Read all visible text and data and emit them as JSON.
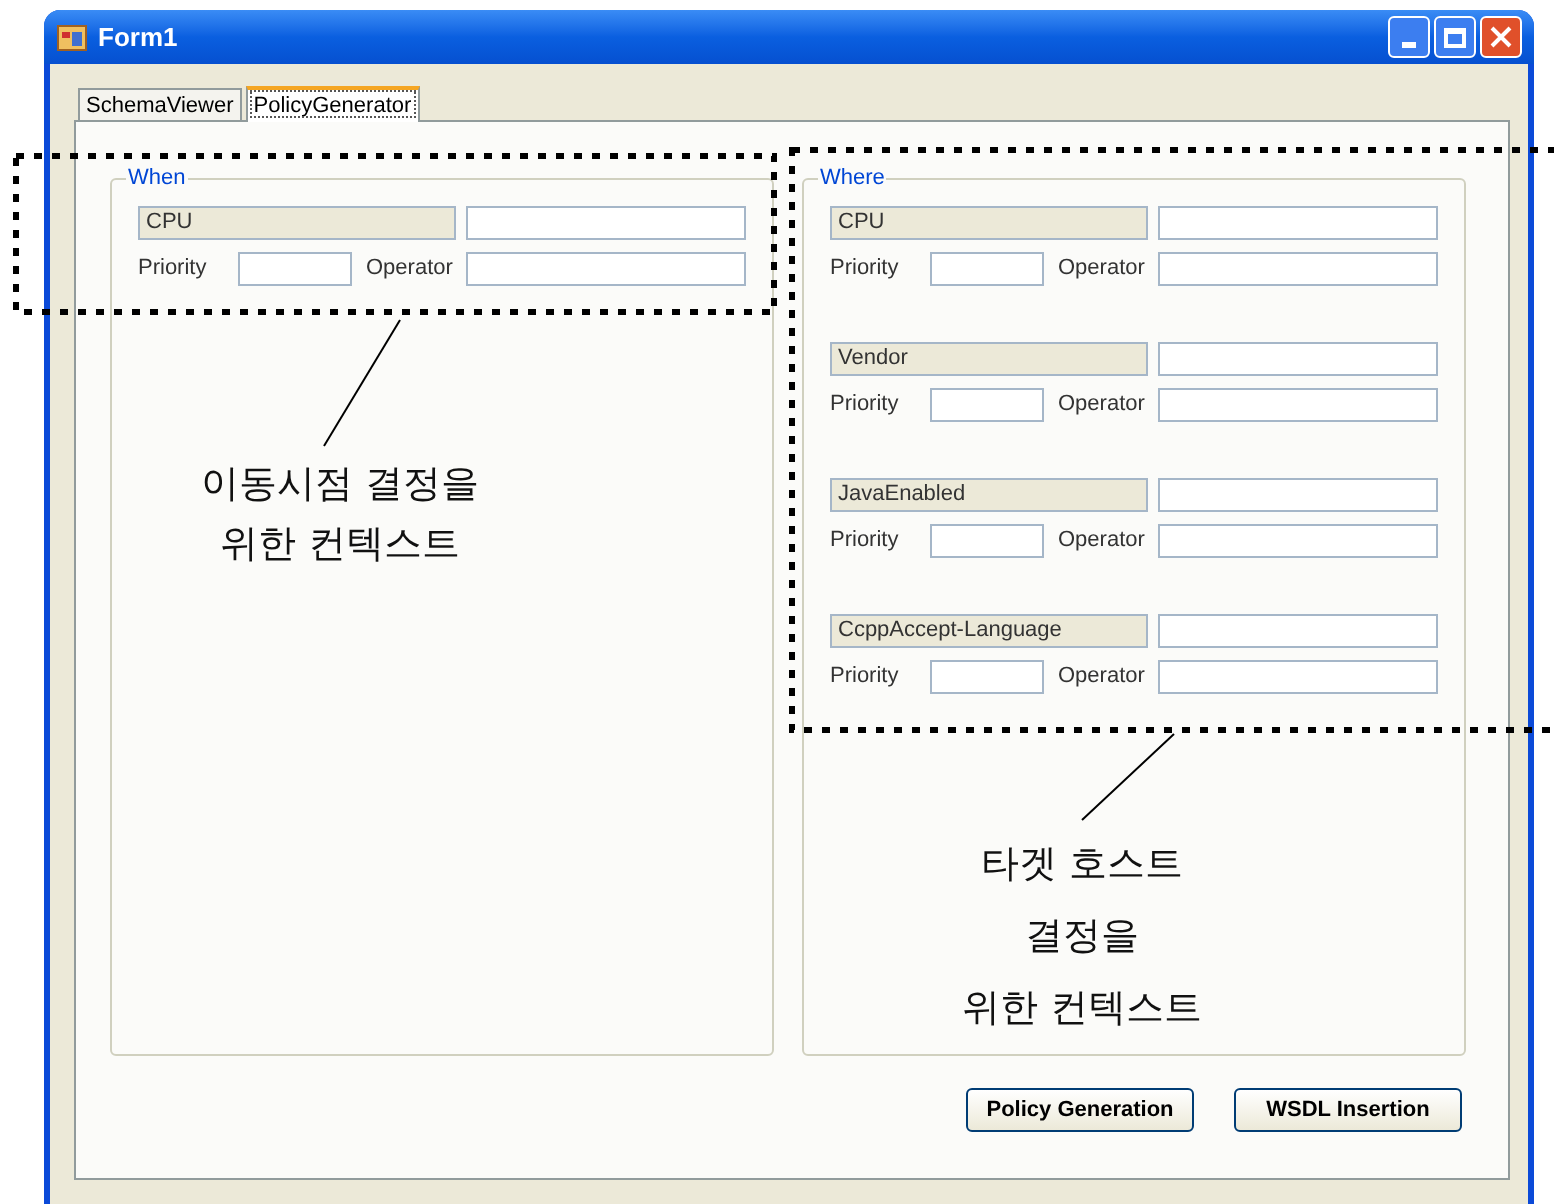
{
  "window": {
    "title": "Form1"
  },
  "tabs": [
    {
      "label": "SchemaViewer",
      "selected": false
    },
    {
      "label": "PolicyGenerator",
      "selected": true
    }
  ],
  "when": {
    "title": "When",
    "properties": [
      {
        "name": "CPU",
        "priority_label": "Priority",
        "operator_label": "Operator"
      }
    ]
  },
  "where": {
    "title": "Where",
    "properties": [
      {
        "name": "CPU",
        "priority_label": "Priority",
        "operator_label": "Operator"
      },
      {
        "name": "Vendor",
        "priority_label": "Priority",
        "operator_label": "Operator"
      },
      {
        "name": "JavaEnabled",
        "priority_label": "Priority",
        "operator_label": "Operator"
      },
      {
        "name": "CcppAccept-Language",
        "priority_label": "Priority",
        "operator_label": "Operator"
      }
    ]
  },
  "buttons": [
    "Policy Generation",
    "WSDL Insertion"
  ],
  "annotations": [
    {
      "lines": [
        "이동시점 결정을",
        "위한 컨텍스트"
      ]
    },
    {
      "lines": [
        "타겟 호스트",
        "결정을",
        "위한 컨텍스트"
      ]
    }
  ]
}
